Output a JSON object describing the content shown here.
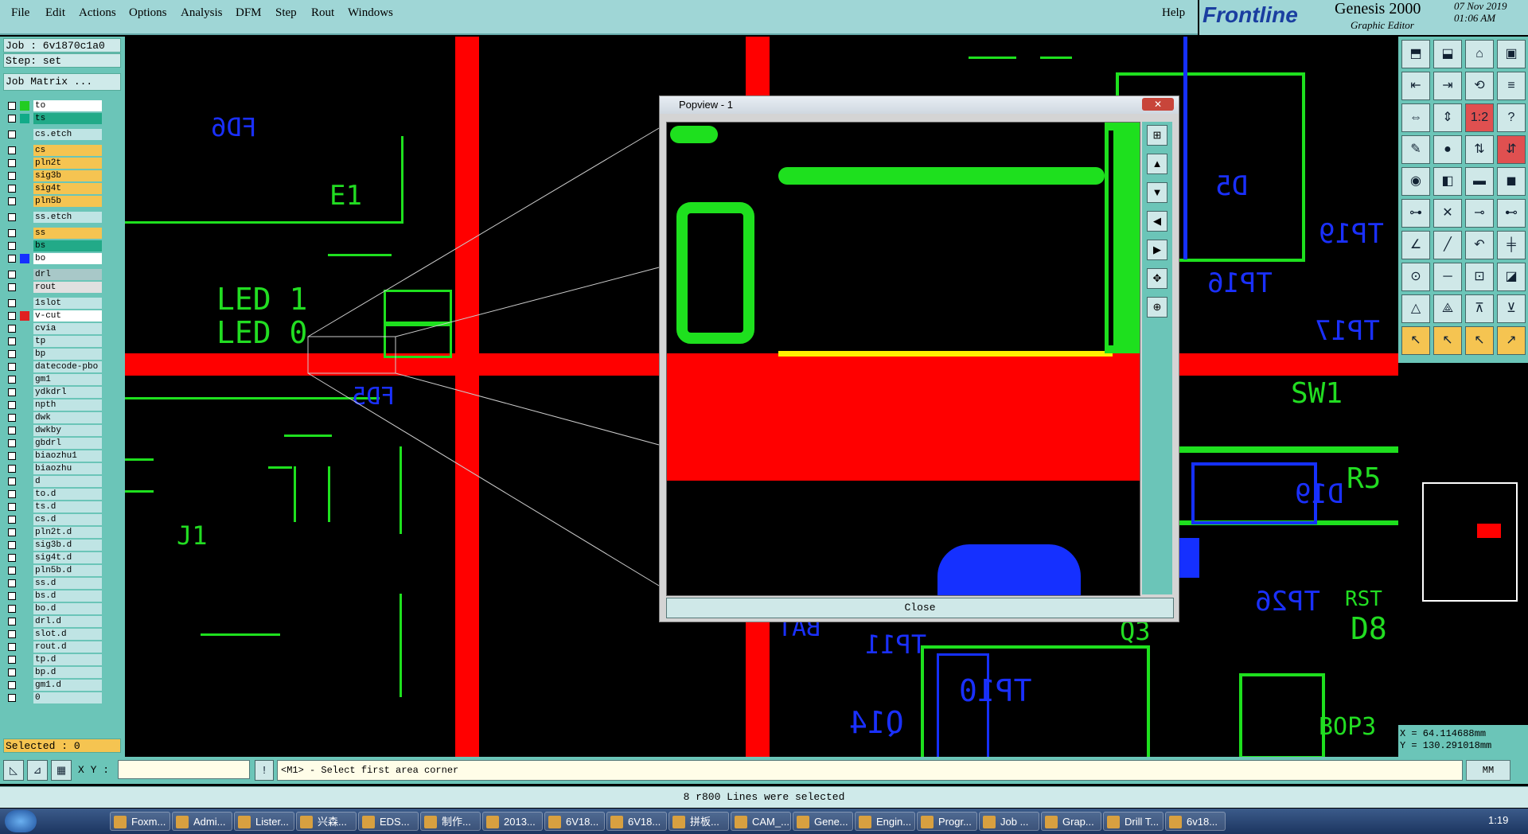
{
  "menu": {
    "items": [
      "File",
      "Edit",
      "Actions",
      "Options",
      "Analysis",
      "DFM",
      "Step",
      "Rout",
      "Windows"
    ],
    "help": "Help"
  },
  "brand": {
    "logo": "Frontline",
    "app": "Genesis 2000",
    "subtitle": "Graphic Editor",
    "date": "07 Nov 2019",
    "time": "01:06 AM"
  },
  "left": {
    "job": "Job : 6v1870c1a0",
    "step": "Step: set",
    "job_matrix": "Job Matrix ...",
    "selected": "Selected : 0"
  },
  "layers": [
    {
      "name": "to",
      "color": "#22cc22",
      "bg": "#ffffff"
    },
    {
      "name": "ts",
      "color": "#11aa88",
      "bg": "#22aa88"
    },
    {
      "name": "cs.etch",
      "color": "",
      "bg": "#bfe4e4"
    },
    {
      "name": "cs",
      "color": "",
      "bg": "#f5c451"
    },
    {
      "name": "pln2t",
      "color": "",
      "bg": "#f5c451"
    },
    {
      "name": "sig3b",
      "color": "",
      "bg": "#f5c451"
    },
    {
      "name": "sig4t",
      "color": "",
      "bg": "#f5c451"
    },
    {
      "name": "pln5b",
      "color": "",
      "bg": "#f5c451"
    },
    {
      "name": "ss.etch",
      "color": "",
      "bg": "#bfe4e4"
    },
    {
      "name": "ss",
      "color": "",
      "bg": "#f5c451"
    },
    {
      "name": "bs",
      "color": "",
      "bg": "#22aa88"
    },
    {
      "name": "bo",
      "color": "#1530ff",
      "bg": "#ffffff"
    },
    {
      "name": "drl",
      "color": "",
      "bg": "#a8c8c8"
    },
    {
      "name": "rout",
      "color": "",
      "bg": "#e0e0e0"
    },
    {
      "name": "1slot",
      "color": "",
      "bg": "#bfe4e4"
    },
    {
      "name": "v-cut",
      "color": "#e02020",
      "bg": "#ffffff"
    },
    {
      "name": "cvia",
      "color": "",
      "bg": "#bfe4e4"
    },
    {
      "name": "tp",
      "color": "",
      "bg": "#bfe4e4"
    },
    {
      "name": "bp",
      "color": "",
      "bg": "#bfe4e4"
    },
    {
      "name": "datecode-pbo",
      "color": "",
      "bg": "#bfe4e4"
    },
    {
      "name": "gm1",
      "color": "",
      "bg": "#bfe4e4"
    },
    {
      "name": "ydkdrl",
      "color": "",
      "bg": "#bfe4e4"
    },
    {
      "name": "npth",
      "color": "",
      "bg": "#bfe4e4"
    },
    {
      "name": "dwk",
      "color": "",
      "bg": "#bfe4e4"
    },
    {
      "name": "dwkby",
      "color": "",
      "bg": "#bfe4e4"
    },
    {
      "name": "gbdrl",
      "color": "",
      "bg": "#bfe4e4"
    },
    {
      "name": "biaozhu1",
      "color": "",
      "bg": "#bfe4e4"
    },
    {
      "name": "biaozhu",
      "color": "",
      "bg": "#bfe4e4"
    },
    {
      "name": "d",
      "color": "",
      "bg": "#bfe4e4"
    },
    {
      "name": "to.d",
      "color": "",
      "bg": "#bfe4e4"
    },
    {
      "name": "ts.d",
      "color": "",
      "bg": "#bfe4e4"
    },
    {
      "name": "cs.d",
      "color": "",
      "bg": "#bfe4e4"
    },
    {
      "name": "pln2t.d",
      "color": "",
      "bg": "#bfe4e4"
    },
    {
      "name": "sig3b.d",
      "color": "",
      "bg": "#bfe4e4"
    },
    {
      "name": "sig4t.d",
      "color": "",
      "bg": "#bfe4e4"
    },
    {
      "name": "pln5b.d",
      "color": "",
      "bg": "#bfe4e4"
    },
    {
      "name": "ss.d",
      "color": "",
      "bg": "#bfe4e4"
    },
    {
      "name": "bs.d",
      "color": "",
      "bg": "#bfe4e4"
    },
    {
      "name": "bo.d",
      "color": "",
      "bg": "#bfe4e4"
    },
    {
      "name": "drl.d",
      "color": "",
      "bg": "#bfe4e4"
    },
    {
      "name": "slot.d",
      "color": "",
      "bg": "#bfe4e4"
    },
    {
      "name": "rout.d",
      "color": "",
      "bg": "#bfe4e4"
    },
    {
      "name": "tp.d",
      "color": "",
      "bg": "#bfe4e4"
    },
    {
      "name": "bp.d",
      "color": "",
      "bg": "#bfe4e4"
    },
    {
      "name": "gm1.d",
      "color": "",
      "bg": "#bfe4e4"
    },
    {
      "name": "0",
      "color": "",
      "bg": "#bfe4e4"
    }
  ],
  "canvas_text": {
    "fd6": "FD6",
    "e1": "E1",
    "led1": "LED 1",
    "led0": "LED 0",
    "fd5": "FD5",
    "j1": "J1",
    "d5": "D5",
    "tp19": "TP19",
    "tp16": "TP16",
    "tp17": "TP17",
    "sw1": "SW1",
    "r5": "R5",
    "d19": "D19",
    "tp26": "TP26",
    "rst": "RST",
    "q3": "Q3",
    "d8": "D8",
    "bat": "BAT",
    "tp11": "TP11",
    "tp10": "TP10",
    "q14": "Q14",
    "bop3": "BOP3"
  },
  "popview": {
    "title": "Popview - 1",
    "close_x": "✕",
    "close_button": "Close"
  },
  "coords": {
    "x": "X = 64.114688mm",
    "y": "Y = 130.291018mm"
  },
  "cmd": {
    "xy_label": "X Y :",
    "xy_value": "",
    "prompt": "<M1> - Select first area corner",
    "units": "MM"
  },
  "status": "8 r800 Lines were selected",
  "taskbar": {
    "items": [
      "Foxm...",
      "Admi...",
      "Lister...",
      "兴森...",
      "EDS...",
      "制作...",
      "2013...",
      "6V18...",
      "6V18...",
      "拼板...",
      "CAM_...",
      "Gene...",
      "Engin...",
      "Progr...",
      "Job ...",
      "Grap...",
      "Drill T...",
      "6v18..."
    ],
    "clock": "1:19"
  },
  "colors": {
    "panel": "#6bc5b8",
    "menubar": "#9fd6d6",
    "top_layer": "#1ee01e",
    "bottom_layer": "#1530ff",
    "vcut": "#ff0000"
  }
}
